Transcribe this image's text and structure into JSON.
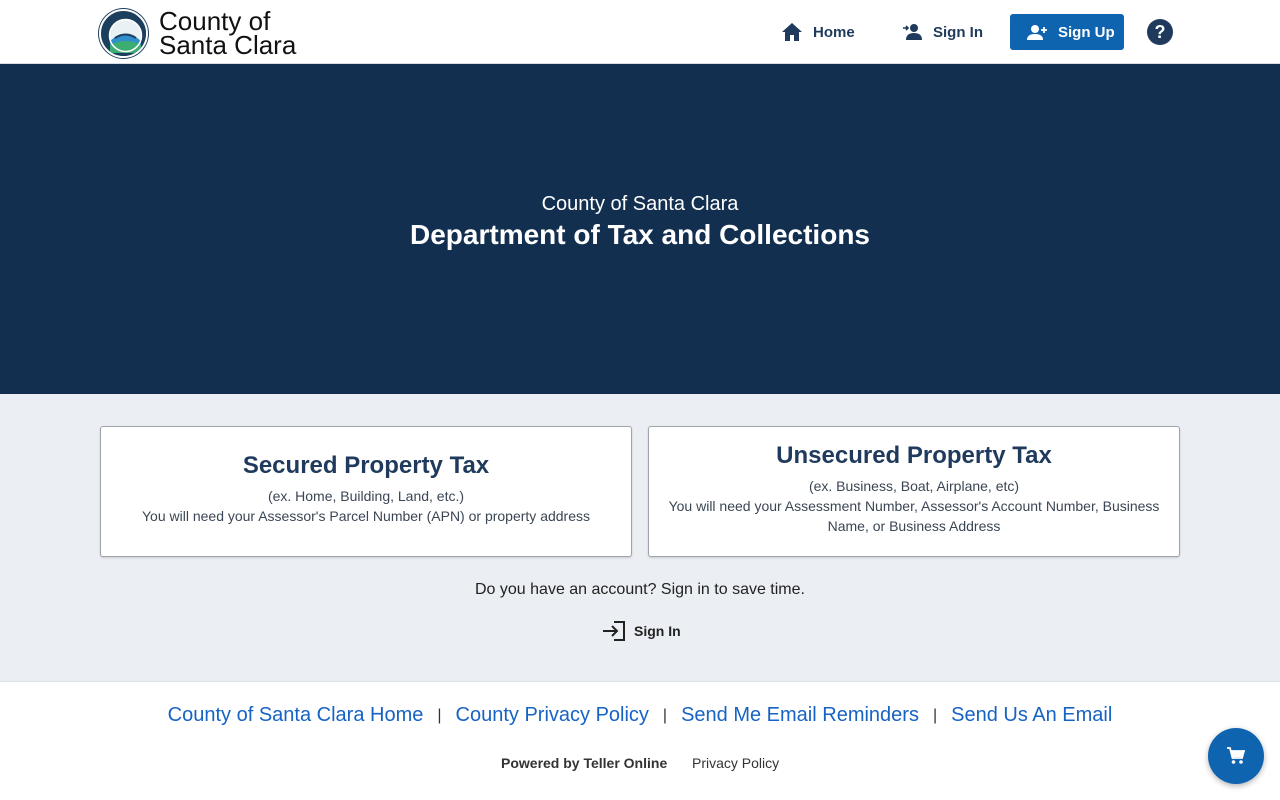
{
  "header": {
    "logo_line1": "County of",
    "logo_line2": "Santa Clara",
    "nav": {
      "home": "Home",
      "sign_in": "Sign In",
      "sign_up": "Sign Up",
      "help": "?"
    }
  },
  "hero": {
    "subtitle": "County of Santa Clara",
    "title": "Department of Tax and Collections"
  },
  "cards": [
    {
      "title": "Secured Property Tax",
      "example": "(ex. Home, Building, Land, etc.)",
      "requirement": "You will need your Assessor's Parcel Number (APN) or property address"
    },
    {
      "title": "Unsecured Property Tax",
      "example": "(ex. Business, Boat, Airplane, etc)",
      "requirement": "You will need your Assessment Number, Assessor's Account Number, Business Name, or Business Address"
    }
  ],
  "account": {
    "prompt": "Do you have an account? Sign in to save time.",
    "sign_in": "Sign In"
  },
  "footer": {
    "links": [
      "County of Santa Clara Home",
      "County Privacy Policy",
      "Send Me Email Reminders",
      "Send Us An Email"
    ],
    "separator": "|",
    "powered_by": "Powered by Teller Online",
    "privacy": "Privacy Policy"
  },
  "icons": {
    "home": "home-icon",
    "sign_in": "person-icon",
    "sign_up": "person-add-icon",
    "help": "help-icon",
    "login": "login-icon",
    "cart": "cart-icon"
  },
  "colors": {
    "header_bg": "#ffffff",
    "hero_bg": "#132f50",
    "main_bg": "#ebeff3",
    "primary": "#0f64b0",
    "nav_text": "#1f3a5c",
    "link": "#1663c4"
  }
}
